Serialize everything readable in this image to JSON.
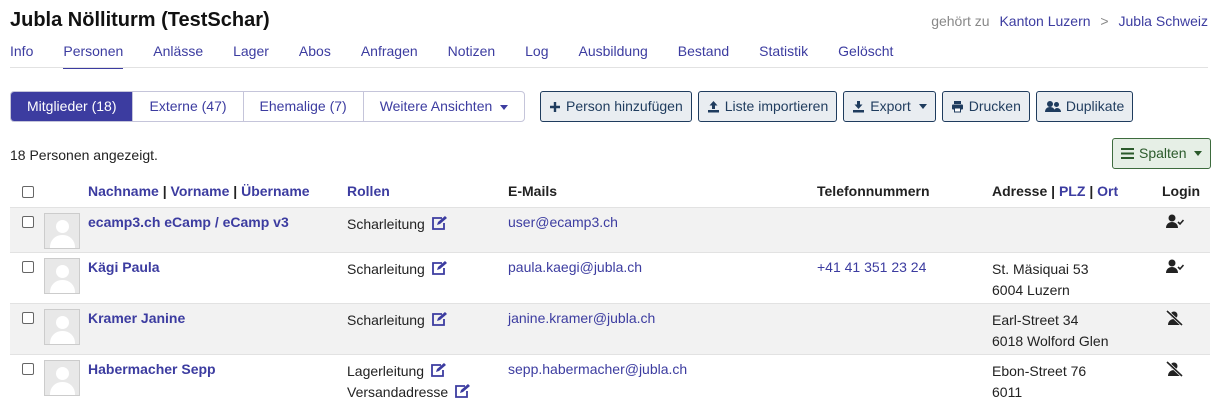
{
  "header": {
    "title": "Jubla Nölliturm (TestSchar)",
    "crumb_prefix": "gehört zu",
    "crumb1": "Kanton Luzern",
    "crumb_sep": ">",
    "crumb2": "Jubla Schweiz"
  },
  "nav": {
    "tabs": [
      "Info",
      "Personen",
      "Anlässe",
      "Lager",
      "Abos",
      "Anfragen",
      "Notizen",
      "Log",
      "Ausbildung",
      "Bestand",
      "Statistik",
      "Gelöscht"
    ],
    "active": "Personen"
  },
  "views": {
    "members": "Mitglieder (18)",
    "externals": "Externe (47)",
    "former": "Ehemalige (7)",
    "more": "Weitere Ansichten"
  },
  "actions": {
    "add_person": "Person hinzufügen",
    "import_list": "Liste importieren",
    "export": "Export",
    "print": "Drucken",
    "duplicates": "Duplikate"
  },
  "list": {
    "count_text": "18 Personen angezeigt.",
    "columns_button": "Spalten"
  },
  "table": {
    "headers": {
      "lastname": "Nachname",
      "firstname": "Vorname",
      "nickname": "Übername",
      "sep": "|",
      "roles": "Rollen",
      "emails": "E-Mails",
      "phones": "Telefonnummern",
      "address": "Adresse",
      "zip": "PLZ",
      "town": "Ort",
      "login": "Login"
    },
    "rows": [
      {
        "name": "ecamp3.ch eCamp / eCamp v3",
        "role1": "Scharleitung",
        "role2": "",
        "email": "user@ecamp3.ch",
        "phone": "",
        "street": "",
        "city": "",
        "login": "login-active"
      },
      {
        "name": "Kägi Paula",
        "role1": "Scharleitung",
        "role2": "",
        "email": "paula.kaegi@jubla.ch",
        "phone": "+41 41 351 23 24",
        "street": "St. Mäsiquai 53",
        "city": "6004 Luzern",
        "login": "login-active"
      },
      {
        "name": "Kramer Janine",
        "role1": "Scharleitung",
        "role2": "",
        "email": "janine.kramer@jubla.ch",
        "phone": "",
        "street": "Earl-Street 34",
        "city": "6018 Wolford Glen",
        "login": "login-none"
      },
      {
        "name": "Habermacher Sepp",
        "role1": "Lagerleitung",
        "role2": "Versandadresse",
        "email": "sepp.habermacher@jubla.ch",
        "phone": "",
        "street": "Ebon-Street 76",
        "city": "6011",
        "login": "login-none"
      }
    ]
  },
  "colors": {
    "accent": "#3c3ca0",
    "button_blue": "#1f3c5e",
    "button_green": "#2b5a2b"
  }
}
